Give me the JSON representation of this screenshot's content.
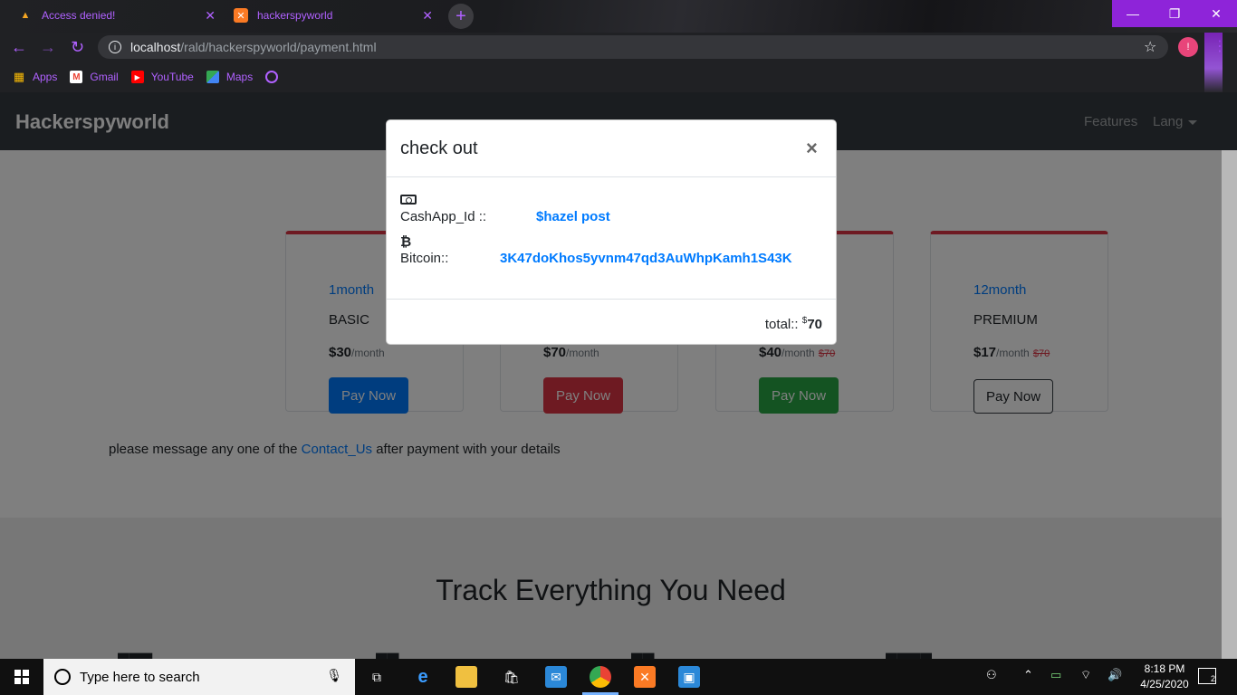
{
  "browser": {
    "tabs": [
      {
        "title": "Access denied!",
        "favicon": "warning-logo-icon"
      },
      {
        "title": "hackerspyworld",
        "favicon": "xampp-icon"
      }
    ],
    "url_host": "localhost",
    "url_path": "/rald/hackerspyworld/payment.html",
    "profile_initial": "!",
    "bookmarks": [
      {
        "label": "Apps",
        "icon": "apps-grid-icon"
      },
      {
        "label": "Gmail",
        "icon": "gmail-icon"
      },
      {
        "label": "YouTube",
        "icon": "youtube-icon"
      },
      {
        "label": "Maps",
        "icon": "maps-icon"
      }
    ]
  },
  "site": {
    "brand": "Hackerspyworld",
    "nav": {
      "features": "Features",
      "lang": "Lang"
    },
    "cards": [
      {
        "period": "1month",
        "plan": "BASIC",
        "price": "$30",
        "per": "/month",
        "old": "",
        "button": "Pay Now"
      },
      {
        "period": "",
        "plan": "",
        "price": "$70",
        "per": "/month",
        "old": "",
        "button": "Pay Now"
      },
      {
        "period": "",
        "plan": "",
        "price": "$40",
        "per": "/month",
        "old": "$70",
        "button": "Pay Now"
      },
      {
        "period": "12month",
        "plan": "PREMIUM",
        "price": "$17",
        "per": "/month",
        "old": "$70",
        "button": "Pay Now"
      }
    ],
    "note_before": "please message any one of the ",
    "note_link": "Contact_Us",
    "note_after": " after payment with your details",
    "section_title": "Track Everything You Need"
  },
  "modal": {
    "title": "check out",
    "close": "×",
    "cashapp_label": "CashApp_Id ::",
    "cashapp_value": "$hazel post",
    "bitcoin_symbol": "₿",
    "bitcoin_label": "Bitcoin::",
    "bitcoin_value": "3K47doKhos5yvnm47qd3AuWhpKamh1S43K",
    "total_label": "total::",
    "total_currency": "$",
    "total_value": "70"
  },
  "taskbar": {
    "search_placeholder": "Type here to search",
    "time": "8:18 PM",
    "date": "4/25/2020",
    "notification_count": "2"
  }
}
